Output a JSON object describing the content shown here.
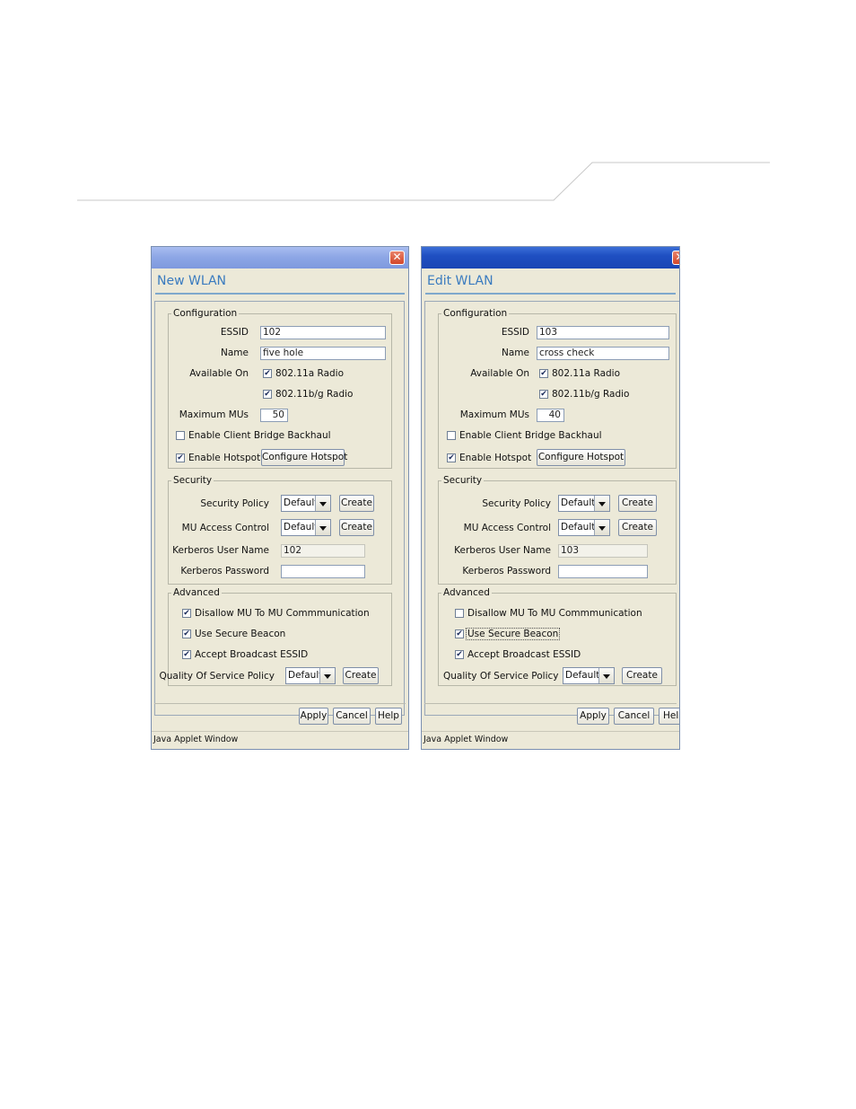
{
  "dialogs": [
    {
      "title": "New WLAN",
      "configuration": {
        "legend": "Configuration",
        "essid_label": "ESSID",
        "essid_value": "102",
        "name_label": "Name",
        "name_value": "five hole",
        "available_on_label": "Available On",
        "radio_a_label": "802.11a Radio",
        "radio_a_checked": true,
        "radio_bg_label": "802.11b/g Radio",
        "radio_bg_checked": true,
        "max_mus_label": "Maximum MUs",
        "max_mus_value": "50",
        "bridge_label": "Enable Client Bridge Backhaul",
        "bridge_checked": false,
        "hotspot_label": "Enable Hotspot",
        "hotspot_checked": true,
        "configure_hotspot_label": "Configure Hotspot"
      },
      "security": {
        "legend": "Security",
        "policy_label": "Security Policy",
        "policy_value": "Default",
        "access_label": "MU Access Control",
        "access_value": "Default",
        "create_label": "Create",
        "kerb_user_label": "Kerberos User Name",
        "kerb_user_value": "102",
        "kerb_pass_label": "Kerberos Password",
        "kerb_pass_value": ""
      },
      "advanced": {
        "legend": "Advanced",
        "disallow_label": "Disallow MU To MU Commmunication",
        "disallow_checked": true,
        "beacon_label": "Use Secure Beacon",
        "beacon_checked": true,
        "broadcast_label": "Accept Broadcast ESSID",
        "broadcast_checked": true,
        "qos_label": "Quality Of Service Policy",
        "qos_value": "Default",
        "create_label": "Create"
      },
      "buttons": {
        "apply": "Apply",
        "cancel": "Cancel",
        "help": "Help"
      },
      "status": "Java Applet Window"
    },
    {
      "title": "Edit WLAN",
      "configuration": {
        "legend": "Configuration",
        "essid_label": "ESSID",
        "essid_value": "103",
        "name_label": "Name",
        "name_value": "cross check",
        "available_on_label": "Available On",
        "radio_a_label": "802.11a Radio",
        "radio_a_checked": true,
        "radio_bg_label": "802.11b/g Radio",
        "radio_bg_checked": true,
        "max_mus_label": "Maximum MUs",
        "max_mus_value": "40",
        "bridge_label": "Enable Client Bridge Backhaul",
        "bridge_checked": false,
        "hotspot_label": "Enable Hotspot",
        "hotspot_checked": true,
        "configure_hotspot_label": "Configure Hotspot"
      },
      "security": {
        "legend": "Security",
        "policy_label": "Security Policy",
        "policy_value": "Default",
        "access_label": "MU Access Control",
        "access_value": "Default",
        "create_label": "Create",
        "kerb_user_label": "Kerberos User Name",
        "kerb_user_value": "103",
        "kerb_pass_label": "Kerberos Password",
        "kerb_pass_value": ""
      },
      "advanced": {
        "legend": "Advanced",
        "disallow_label": "Disallow MU To MU Commmunication",
        "disallow_checked": false,
        "beacon_label": "Use Secure Beacon",
        "beacon_checked": true,
        "broadcast_label": "Accept Broadcast ESSID",
        "broadcast_checked": true,
        "qos_label": "Quality Of Service Policy",
        "qos_value": "Default",
        "create_label": "Create"
      },
      "buttons": {
        "apply": "Apply",
        "cancel": "Cancel",
        "help": "Help"
      },
      "status": "Java Applet Window"
    }
  ],
  "icons": {
    "close": "close-icon",
    "check": "check-mark-icon",
    "dropdown": "chevron-down-icon"
  },
  "colors": {
    "title_text": "#3a7bbf",
    "active_titlebar": "#1f4fc2",
    "inactive_titlebar": "#8ea7e6",
    "close_button": "#d2472a"
  }
}
